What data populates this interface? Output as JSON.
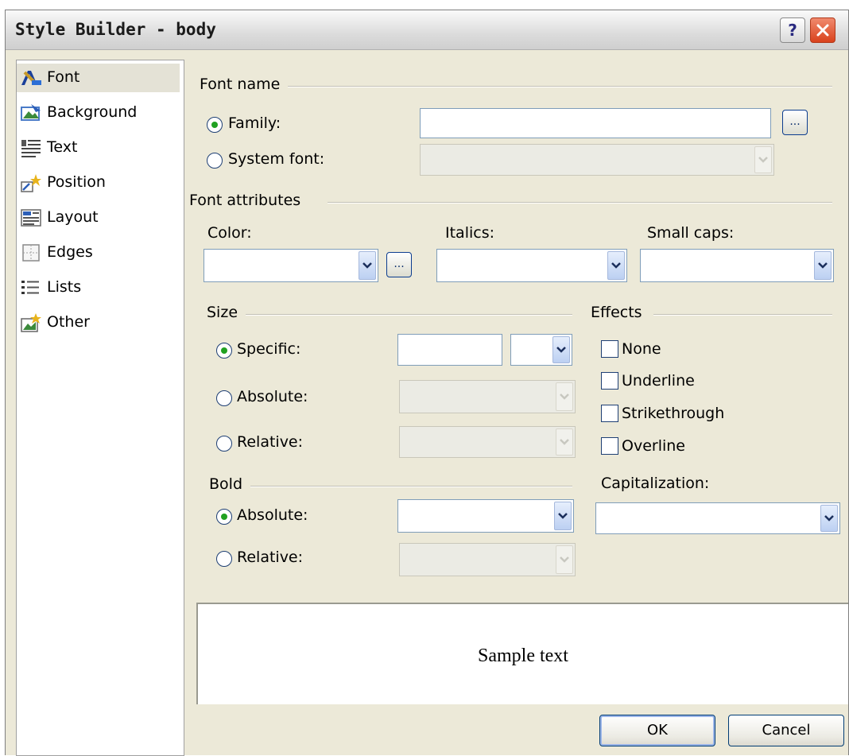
{
  "window": {
    "title": "Style Builder - body",
    "help_glyph": "?"
  },
  "sidebar": {
    "items": [
      {
        "label": "Font",
        "icon": "font-icon"
      },
      {
        "label": "Background",
        "icon": "background-icon"
      },
      {
        "label": "Text",
        "icon": "text-icon"
      },
      {
        "label": "Position",
        "icon": "position-icon"
      },
      {
        "label": "Layout",
        "icon": "layout-icon"
      },
      {
        "label": "Edges",
        "icon": "edges-icon"
      },
      {
        "label": "Lists",
        "icon": "lists-icon"
      },
      {
        "label": "Other",
        "icon": "other-icon"
      }
    ],
    "selected": "Font"
  },
  "font_name": {
    "group_label": "Font name",
    "family_label": "Family:",
    "family_value": "",
    "system_font_label": "System font:",
    "browse_glyph": "...",
    "selected": "Family"
  },
  "font_attributes": {
    "group_label": "Font attributes",
    "color_label": "Color:",
    "color_browse_glyph": "...",
    "italics_label": "Italics:",
    "small_caps_label": "Small caps:"
  },
  "size": {
    "group_label": "Size",
    "specific_label": "Specific:",
    "absolute_label": "Absolute:",
    "relative_label": "Relative:",
    "selected": "Specific"
  },
  "effects": {
    "group_label": "Effects",
    "options": [
      "None",
      "Underline",
      "Strikethrough",
      "Overline"
    ]
  },
  "bold": {
    "group_label": "Bold",
    "absolute_label": "Absolute:",
    "relative_label": "Relative:",
    "selected": "Absolute"
  },
  "capitalization": {
    "label": "Capitalization:"
  },
  "preview": {
    "text": "Sample text"
  },
  "buttons": {
    "ok": "OK",
    "cancel": "Cancel"
  },
  "colors": {
    "dialog_background": "#ece9d8",
    "field_border": "#7f9db9",
    "radio_dot": "#21a121",
    "close_button": "#d9421c"
  }
}
